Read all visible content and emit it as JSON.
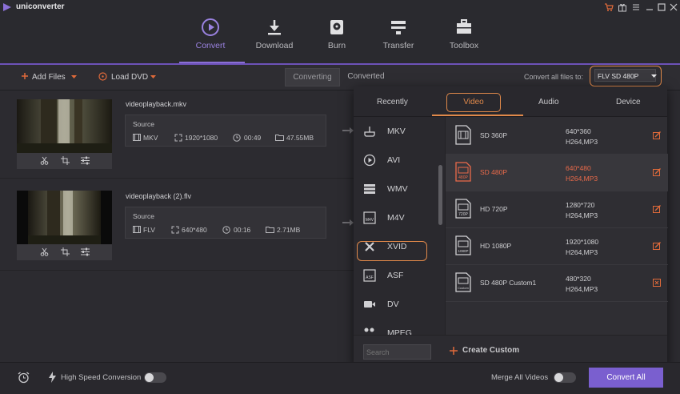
{
  "app": {
    "title": "uniconverter"
  },
  "colors": {
    "accent_purple": "#7a5fcf",
    "highlight_orange": "#e0894a",
    "selected_red": "#ea6a4a",
    "background": "#2c2b30"
  },
  "nav": [
    {
      "label": "Convert",
      "icon": "convert-play-icon",
      "active": true
    },
    {
      "label": "Download",
      "icon": "download-icon",
      "active": false
    },
    {
      "label": "Burn",
      "icon": "disc-burn-icon",
      "active": false
    },
    {
      "label": "Transfer",
      "icon": "transfer-icon",
      "active": false
    },
    {
      "label": "Toolbox",
      "icon": "toolbox-icon",
      "active": false
    }
  ],
  "toolbar": {
    "add_files": "Add Files",
    "load_dvd": "Load DVD",
    "converting": "Converting",
    "converted": "Converted",
    "convert_all_to_label": "Convert all files to:",
    "convert_all_to_value": "FLV SD 480P"
  },
  "files": [
    {
      "name": "videoplayback.mkv",
      "source_label": "Source",
      "format": "MKV",
      "resolution": "1920*1080",
      "duration": "00:49",
      "size": "47.55MB"
    },
    {
      "name": "videoplayback (2).flv",
      "source_label": "Source",
      "format": "FLV",
      "resolution": "640*480",
      "duration": "00:16",
      "size": "2.71MB"
    }
  ],
  "panel": {
    "tabs": [
      "Recently",
      "Video",
      "Audio",
      "Device"
    ],
    "active_tab": "Video",
    "categories": [
      "MKV",
      "AVI",
      "WMV",
      "M4V",
      "XVID",
      "ASF",
      "DV",
      "MPEG"
    ],
    "selected_category": "M4V",
    "formats": [
      {
        "name": "SD 360P",
        "res": "640*360",
        "codec": "H264,MP3",
        "icon": "SD",
        "action": "edit-icon"
      },
      {
        "name": "SD 480P",
        "res": "640*480",
        "codec": "H264,MP3",
        "icon": "480P",
        "action": "edit-icon",
        "selected": true
      },
      {
        "name": "HD 720P",
        "res": "1280*720",
        "codec": "H264,MP3",
        "icon": "720P",
        "action": "edit-icon"
      },
      {
        "name": "HD 1080P",
        "res": "1920*1080",
        "codec": "H264,MP3",
        "icon": "1080P",
        "action": "edit-icon"
      },
      {
        "name": "SD 480P Custom1",
        "res": "480*320",
        "codec": "H264,MP3",
        "icon": "Custom",
        "action": "delete-icon"
      }
    ],
    "search_placeholder": "Search",
    "create_custom": "Create Custom"
  },
  "bottom": {
    "high_speed": "High Speed Conversion",
    "merge": "Merge All Videos",
    "convert_all": "Convert All"
  }
}
